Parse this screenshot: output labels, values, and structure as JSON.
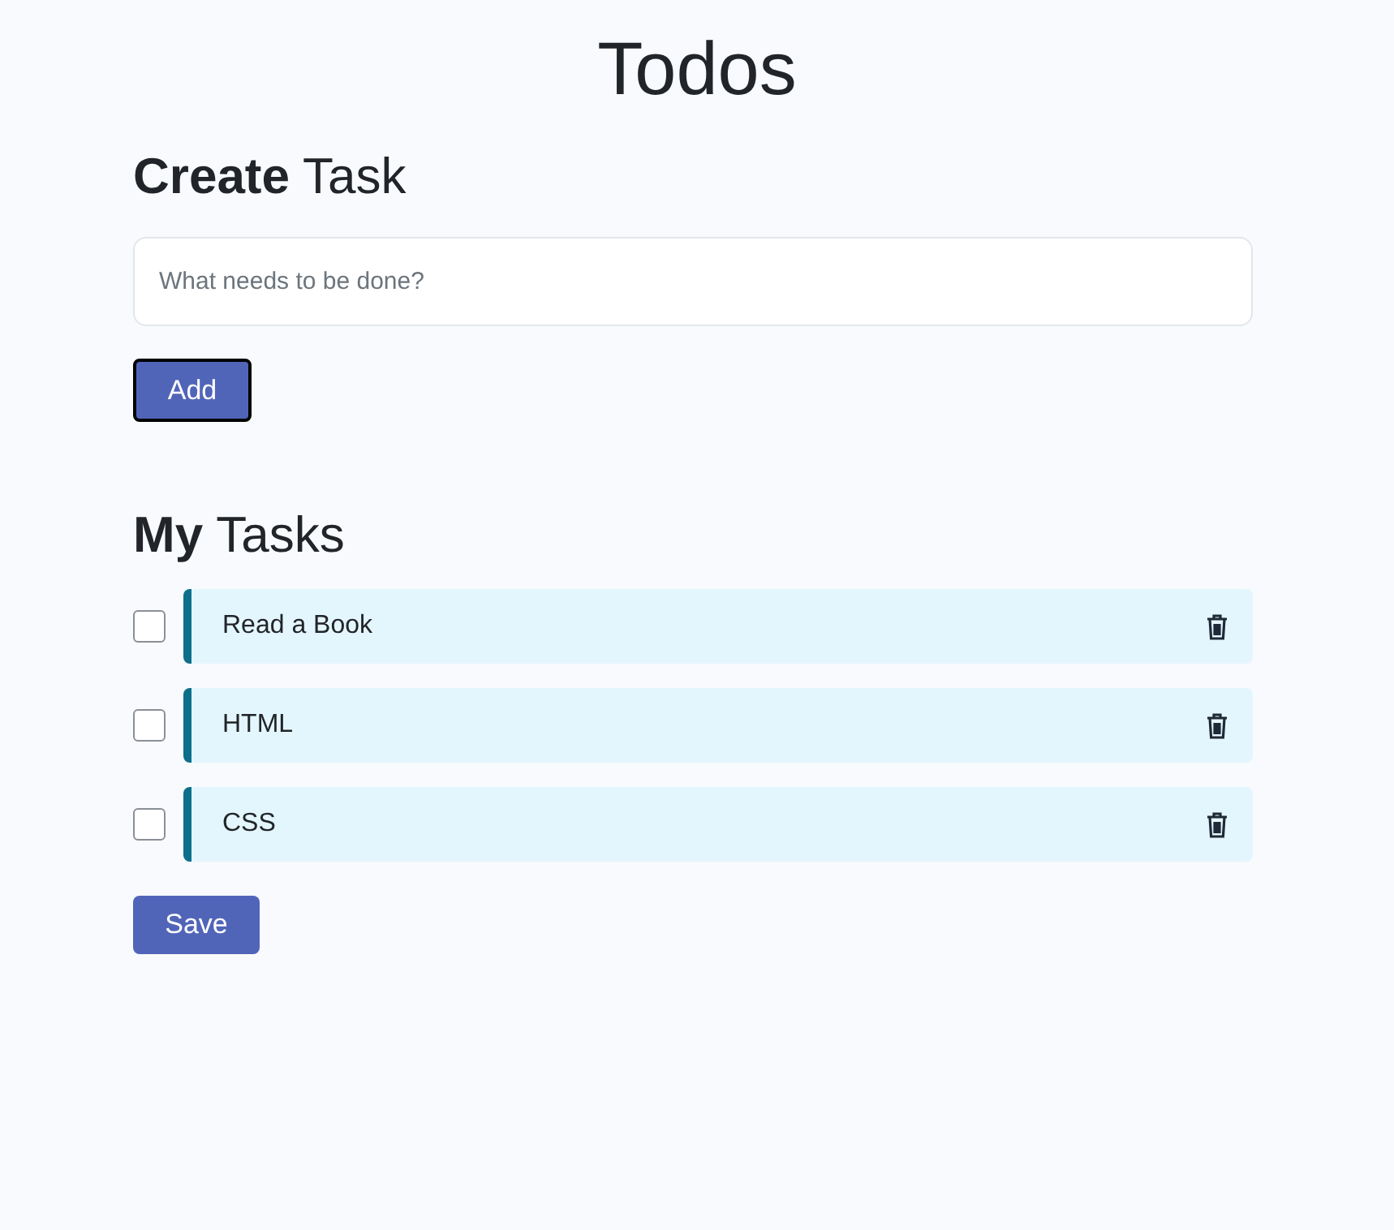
{
  "title": "Todos",
  "create": {
    "heading": "**Create** Task",
    "input": {
      "placeholder": "What needs to be done?"
    },
    "button": "Add"
  },
  "list": {
    "heading": "**My** Tasks",
    "tasks": [
      {
        "label": "Read a Book",
        "checked": false
      },
      {
        "label": "HTML",
        "checked": false
      },
      {
        "label": "CSS",
        "checked": false
      }
    ],
    "button": "Save"
  }
}
